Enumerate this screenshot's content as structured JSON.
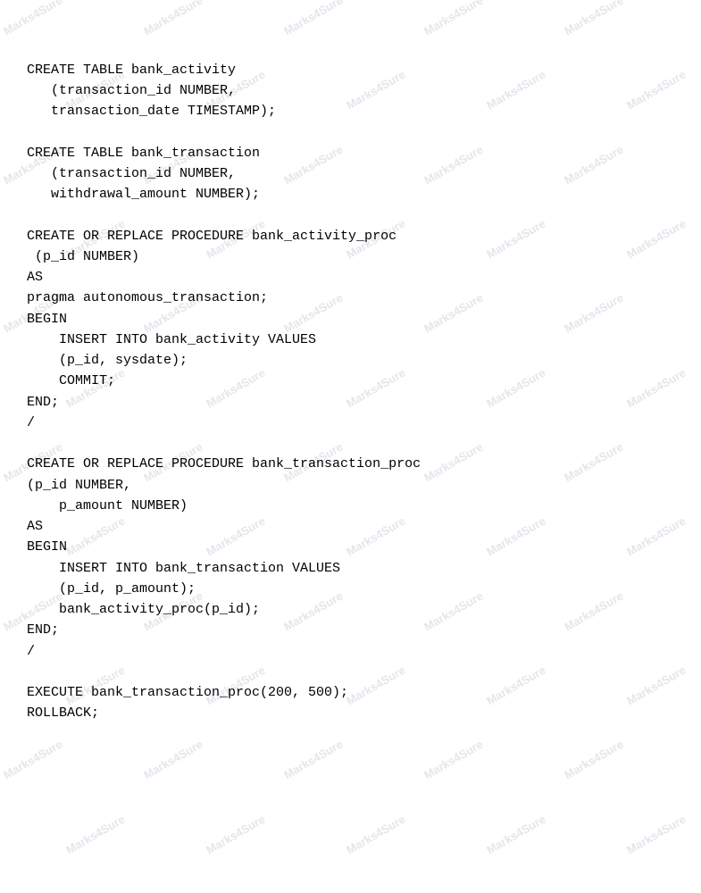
{
  "watermark": {
    "text": "Marks4Sure"
  },
  "code": {
    "lines": [
      "CREATE TABLE bank_activity",
      "   (transaction_id NUMBER,",
      "   transaction_date TIMESTAMP);",
      "",
      "CREATE TABLE bank_transaction",
      "   (transaction_id NUMBER,",
      "   withdrawal_amount NUMBER);",
      "",
      "CREATE OR REPLACE PROCEDURE bank_activity_proc",
      " (p_id NUMBER)",
      "AS",
      "pragma autonomous_transaction;",
      "BEGIN",
      "    INSERT INTO bank_activity VALUES",
      "    (p_id, sysdate);",
      "    COMMIT;",
      "END;",
      "/",
      "",
      "CREATE OR REPLACE PROCEDURE bank_transaction_proc",
      "(p_id NUMBER,",
      "    p_amount NUMBER)",
      "AS",
      "BEGIN",
      "    INSERT INTO bank_transaction VALUES",
      "    (p_id, p_amount);",
      "    bank_activity_proc(p_id);",
      "END;",
      "/",
      "",
      "EXECUTE bank_transaction_proc(200, 500);",
      "ROLLBACK;"
    ]
  }
}
